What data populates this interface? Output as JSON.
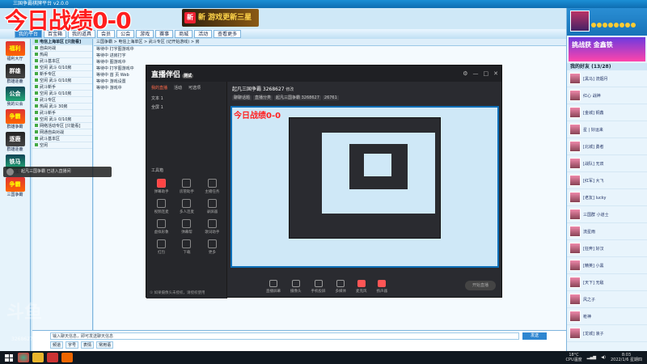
{
  "overlay": {
    "score_text": "今日战绩0-0"
  },
  "client": {
    "title": "三国争霸棋牌平台 v2.0.0",
    "banner_text": "新 游戏更新三星",
    "banner_badge": "新",
    "toolbar": [
      "我的平台",
      "百宝箱",
      "我的道具",
      "会员",
      "公会",
      "游戏",
      "赛事",
      "商城",
      "活动",
      "查看更多"
    ],
    "left_apps": [
      {
        "label": "福利大厅",
        "text": "福利"
      },
      {
        "label": "群雄逐鹿",
        "text": "群雄"
      },
      {
        "label": "我的公会",
        "text": "公会"
      },
      {
        "label": "群雄争霸",
        "text": "争霸"
      },
      {
        "label": "群雄逐鹿",
        "text": "逐鹿"
      },
      {
        "label": "金戈铁马",
        "text": "铁马"
      },
      {
        "label": "三国争霸",
        "text": "争霸"
      }
    ],
    "rooms": [
      {
        "text": "电信上海单区 [只能看]",
        "hdr": true
      },
      {
        "text": "自由对战"
      },
      {
        "text": "热闹"
      },
      {
        "text": "武斗基本区"
      },
      {
        "text": "空闲 武斗 0/10房"
      },
      {
        "text": "新手专区"
      },
      {
        "text": "空闲 武斗 0/10房"
      },
      {
        "text": "武斗新手"
      },
      {
        "text": "空闲 武斗 0/10房"
      },
      {
        "text": "武斗专区"
      },
      {
        "text": "热闹 武斗 30房"
      },
      {
        "text": "武斗新手"
      },
      {
        "text": "空闲 武斗 0/10房"
      },
      {
        "text": "网络活动专区 [只能看]"
      },
      {
        "text": "网通自由对战"
      },
      {
        "text": "武斗基本区"
      },
      {
        "text": "空闲"
      }
    ],
    "main_path": "三国争霸 > 电信上海单区 > 武斗专区 (记开始游戏) > 房",
    "main_rows": [
      "等待中   打字图游戏中",
      "等待中   进房打字",
      "等待中   图游戏中",
      "等待中   打字图游戏中",
      "等待中   首 页 Web",
      "等待中   游戏设置",
      "等待中   游戏中"
    ],
    "chat_placeholder": "输入聊天信息，即可发送聊天信息",
    "chat_tools": [
      "频道",
      "字号",
      "表情",
      "常用语"
    ],
    "chat_send": "发送",
    "friends_header": "我的好友 (13/28)",
    "ad_text": "挑战获 金鑫铁",
    "friends": [
      "[黑马] 流烟月",
      "红心 战神",
      "[金城] 铜鑫",
      "星 | 好运来",
      "[北城] 勇者",
      "[战队] 无双",
      "[红军] 大飞",
      "[老友] lucky",
      "三国群 小道士",
      "流星雨",
      "[狂奔] 好汉",
      "[精英] 小黑",
      "[天下] 无敌",
      "风之子",
      "枪神",
      "[龙城] 浪子"
    ]
  },
  "stream": {
    "app_name": "直播伴侣",
    "version_tag": "测试",
    "tabs": [
      "我的直播",
      "活动",
      "可选项"
    ],
    "scenes": [
      "文本 1",
      "全屏 1"
    ],
    "tools_header": "工具箱",
    "tools": [
      {
        "label": "弹幕助手",
        "red": true
      },
      {
        "label": "房管助手"
      },
      {
        "label": "主播任务"
      },
      {
        "label": "视频连麦"
      },
      {
        "label": "多人连麦"
      },
      {
        "label": "录屏器"
      },
      {
        "label": "虚拟形象"
      },
      {
        "label": "弹幕帮"
      },
      {
        "label": "歌词助手"
      },
      {
        "label": "红包"
      },
      {
        "label": "下载"
      },
      {
        "label": "更多"
      }
    ],
    "footer_note": "① 如果摄像头未授权，请授权使用",
    "room_name": "起凡三国争霸 3268627",
    "room_tag": "修改",
    "room_sub": [
      "聊聊话题",
      "直播分类",
      "起凡三国争霸 3268627",
      "26761"
    ],
    "bottom_buttons": [
      {
        "label": "直播屏幕"
      },
      {
        "label": "摄像头"
      },
      {
        "label": "手机投屏"
      },
      {
        "label": "多媒体"
      },
      {
        "label": "麦克风",
        "red": true
      },
      {
        "label": "扬声器",
        "red": true
      }
    ],
    "start_btn": "开始直播"
  },
  "toast_text": "起凡三国争霸 已进入直播间",
  "watermark": "斗鱼",
  "watermark_id": "3268627",
  "taskbar": {
    "temp": "18°C",
    "temp_sub": "CPU温度",
    "time": "8:03",
    "date": "2022/1/6 星期四"
  }
}
